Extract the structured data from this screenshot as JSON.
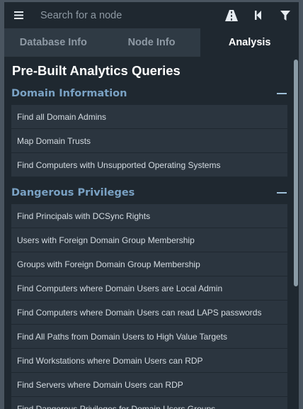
{
  "search": {
    "placeholder": "Search for a node"
  },
  "toolbar": {
    "menu_icon": "hamburger-menu-icon",
    "pathfinding_icon": "road-icon",
    "back_icon": "step-backward-icon",
    "filter_icon": "filter-icon"
  },
  "tabs": [
    {
      "label": "Database Info",
      "active": false
    },
    {
      "label": "Node Info",
      "active": false
    },
    {
      "label": "Analysis",
      "active": true
    }
  ],
  "analysis": {
    "title": "Pre-Built Analytics Queries",
    "sections": [
      {
        "title": "Domain Information",
        "queries": [
          "Find all Domain Admins",
          "Map Domain Trusts",
          "Find Computers with Unsupported Operating Systems"
        ]
      },
      {
        "title": "Dangerous Privileges",
        "queries": [
          "Find Principals with DCSync Rights",
          "Users with Foreign Domain Group Membership",
          "Groups with Foreign Domain Group Membership",
          "Find Computers where Domain Users are Local Admin",
          "Find Computers where Domain Users can read LAPS passwords",
          "Find All Paths from Domain Users to High Value Targets",
          "Find Workstations where Domain Users can RDP",
          "Find Servers where Domain Users can RDP",
          "Find Dangerous Privileges for Domain Users Groups"
        ]
      }
    ]
  },
  "colors": {
    "background": "#1f2830",
    "section_title": "#7aa2c4",
    "query_item": "#2b353f"
  }
}
